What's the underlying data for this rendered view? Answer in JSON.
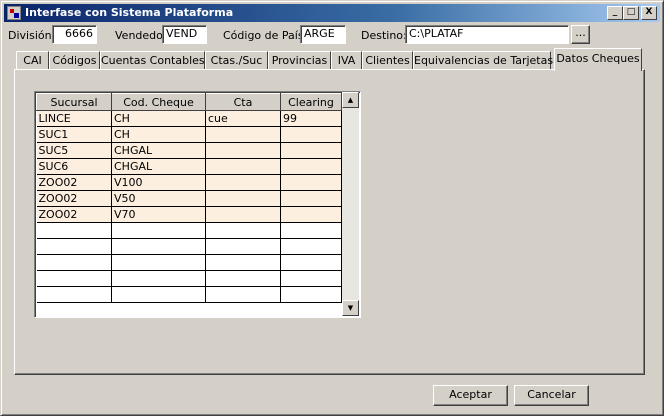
{
  "window": {
    "title": "Interfase con Sistema Plataforma",
    "minimize_glyph": "_",
    "maximize_glyph": "□",
    "close_glyph": "X"
  },
  "header": {
    "division_label": "División:",
    "division_value": "6666",
    "vendedor_label": "Vendedor",
    "vendedor_value": "VEND",
    "pais_label": "Código de País:",
    "pais_value": "ARGE",
    "destino_label": "Destino:",
    "destino_value": "C:\\PLATAF",
    "browse_label": "..."
  },
  "tabs": [
    {
      "label": "CAI"
    },
    {
      "label": "Códigos"
    },
    {
      "label": "Cuentas Contables"
    },
    {
      "label": "Ctas./Suc"
    },
    {
      "label": "Provincias"
    },
    {
      "label": "IVA"
    },
    {
      "label": "Clientes"
    },
    {
      "label": "Equivalencias de Tarjetas"
    },
    {
      "label": "Datos Cheques"
    }
  ],
  "active_tab": "Datos Cheques",
  "grid": {
    "columns": [
      "Sucursal",
      "Cod. Cheque",
      "Cta",
      "Clearing"
    ],
    "rows": [
      [
        "LINCE",
        "CH",
        "cue",
        "99"
      ],
      [
        "SUC1",
        "CH",
        "",
        ""
      ],
      [
        "SUC5",
        "CHGAL",
        "",
        ""
      ],
      [
        "SUC6",
        "CHGAL",
        "",
        ""
      ],
      [
        "ZOO02",
        "V100",
        "",
        ""
      ],
      [
        "ZOO02",
        "V50",
        "",
        ""
      ],
      [
        "ZOO02",
        "V70",
        "",
        ""
      ],
      [
        "",
        "",
        "",
        ""
      ],
      [
        "",
        "",
        "",
        ""
      ],
      [
        "",
        "",
        "",
        ""
      ],
      [
        "",
        "",
        "",
        ""
      ],
      [
        "",
        "",
        "",
        ""
      ]
    ],
    "filled_row_color": "#fcefdf"
  },
  "footer": {
    "accept_label": "Aceptar",
    "cancel_label": "Cancelar"
  },
  "colors": {
    "face": "#d4d0c8",
    "title_start": "#0a246a",
    "title_end": "#a6caf0"
  }
}
